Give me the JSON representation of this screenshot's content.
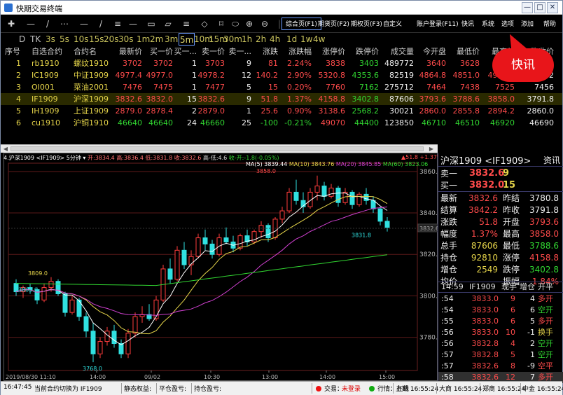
{
  "window": {
    "title": "快期交易终端",
    "controls": [
      "—",
      "□",
      "✕"
    ]
  },
  "toolbar": {
    "tools": [
      "✚",
      "—",
      "/",
      "⋯",
      "▭",
      "▱",
      "≡",
      "⬭",
      "◇",
      "⌑",
      "⊕",
      "⊖",
      "↻"
    ],
    "buttons": [
      "综合页(F1)",
      "期货页(F2)",
      "期权页(F3)",
      "自定义",
      "账户登录(F11)",
      "快讯",
      "系统",
      "选项",
      "添加",
      "帮助"
    ],
    "active_button": "综合页(F1)"
  },
  "periods": {
    "items": [
      "D",
      "TK",
      "3s",
      "5s",
      "10s",
      "15s",
      "20s",
      "30s",
      "1m",
      "2m",
      "3m",
      "5m",
      "10m",
      "15m",
      "30m",
      "1h",
      "2h",
      "4h",
      "1d",
      "1w",
      "4w"
    ],
    "active": "5m"
  },
  "quote_table": {
    "headers": [
      "序号",
      "自选合约",
      "合约名",
      "最新价",
      "买一价",
      "买一...",
      "卖一价",
      "卖一...",
      "涨跌",
      "涨跌幅",
      "涨停价",
      "跌停价",
      "成交量",
      "今开盘",
      "最低价",
      "最高价",
      "昨收价"
    ],
    "rows": [
      {
        "no": "1",
        "code": "rb1910",
        "name": "螺纹1910",
        "last": "3702",
        "bid": "3702",
        "bidvol": "1",
        "ask": "3703",
        "askvol": "9",
        "chg": "81",
        "pct": "2.24%",
        "up": "3838",
        "down": "3403",
        "vol": "489772",
        "open": "3640",
        "low": "3628",
        "high": "3715",
        "prev": "3621",
        "dir": "up"
      },
      {
        "no": "2",
        "code": "IC1909",
        "name": "中证1909",
        "last": "4977.4",
        "bid": "4977.0",
        "bidvol": "1",
        "ask": "4978.2",
        "askvol": "12",
        "chg": "140.2",
        "pct": "2.90%",
        "up": "5320.8",
        "down": "4353.6",
        "vol": "82519",
        "open": "4864.8",
        "low": "4851.0",
        "high": "4998.4",
        "prev": "4837.2",
        "dir": "up"
      },
      {
        "no": "3",
        "code": "OI001",
        "name": "菜油2001",
        "last": "7476",
        "bid": "7475",
        "bidvol": "1",
        "ask": "7477",
        "askvol": "5",
        "chg": "15",
        "pct": "0.20%",
        "up": "7760",
        "down": "7162",
        "vol": "275712",
        "open": "7464",
        "low": "7438",
        "high": "7525",
        "prev": "7456",
        "dir": "up"
      },
      {
        "no": "4",
        "code": "IF1909",
        "name": "沪深1909",
        "last": "3832.6",
        "bid": "3832.0",
        "bidvol": "15",
        "ask": "3832.6",
        "askvol": "9",
        "chg": "51.8",
        "pct": "1.37%",
        "up": "4158.8",
        "down": "3402.8",
        "vol": "87606",
        "open": "3793.6",
        "low": "3788.6",
        "high": "3858.0",
        "prev": "3791.8",
        "dir": "up",
        "selected": true
      },
      {
        "no": "5",
        "code": "IH1909",
        "name": "上证1909",
        "last": "2879.0",
        "bid": "2878.4",
        "bidvol": "2",
        "ask": "2879.0",
        "askvol": "1",
        "chg": "25.6",
        "pct": "0.90%",
        "up": "3138.6",
        "down": "2568.2",
        "vol": "30021",
        "open": "2860.0",
        "low": "2855.8",
        "high": "2894.2",
        "prev": "2860.0",
        "dir": "up"
      },
      {
        "no": "6",
        "code": "cu1910",
        "name": "沪铜1910",
        "last": "46640",
        "bid": "46640",
        "bidvol": "24",
        "ask": "46660",
        "askvol": "25",
        "chg": "-100",
        "pct": "-0.21%",
        "up": "49070",
        "down": "44400",
        "vol": "123850",
        "open": "46710",
        "low": "46510",
        "high": "46920",
        "prev": "46690",
        "dir": "down"
      }
    ]
  },
  "chart_header": {
    "left": "4.沪深1909 <IF1909> 5分钟 ▾",
    "open": "开:3834.4",
    "high": "高:3836.4",
    "low": "低:3831.8",
    "close": "收:3832.6",
    "hl": "高-低:4.6",
    "oc": "收-开:-1.8(-0.05%)",
    "right": "▲51.8 +1.37%"
  },
  "ma_info": [
    "MA(5) 3839.44",
    "MA(10) 3843.76",
    "MA(20) 3845.85",
    "MA(60) 3823.06"
  ],
  "chart_data": {
    "type": "candlestick",
    "y_ticks": [
      "3860.0",
      "3840.0",
      "3820.0",
      "3800.0",
      "3780.0"
    ],
    "ylim": [
      3764,
      3864
    ],
    "x_ticks": [
      "2019/08/30 11:10",
      "14:00",
      "09/02",
      "10:30",
      "13:00",
      "14:00",
      "15:00"
    ],
    "annotations": [
      "3858.0",
      "3809.0",
      "3803.0",
      "3768.0",
      "3831.8"
    ],
    "current_label": "3832.6",
    "candles": [
      [
        3806,
        3808,
        3800,
        3802
      ],
      [
        3802,
        3805,
        3799,
        3804
      ],
      [
        3804,
        3806,
        3801,
        3803
      ],
      [
        3803,
        3804,
        3796,
        3798
      ],
      [
        3798,
        3806,
        3797,
        3804
      ],
      [
        3804,
        3809,
        3802,
        3807
      ],
      [
        3807,
        3808,
        3800,
        3801
      ],
      [
        3801,
        3802,
        3790,
        3792
      ],
      [
        3792,
        3800,
        3791,
        3798
      ],
      [
        3798,
        3799,
        3788,
        3790
      ],
      [
        3790,
        3792,
        3780,
        3783
      ],
      [
        3783,
        3787,
        3768,
        3772
      ],
      [
        3772,
        3780,
        3770,
        3778
      ],
      [
        3778,
        3785,
        3776,
        3783
      ],
      [
        3783,
        3786,
        3775,
        3777
      ],
      [
        3777,
        3779,
        3770,
        3772
      ],
      [
        3772,
        3784,
        3770,
        3782
      ],
      [
        3782,
        3792,
        3780,
        3790
      ],
      [
        3790,
        3795,
        3787,
        3791
      ],
      [
        3791,
        3796,
        3788,
        3789
      ],
      [
        3789,
        3800,
        3788,
        3798
      ],
      [
        3798,
        3815,
        3797,
        3813
      ],
      [
        3813,
        3818,
        3806,
        3808
      ],
      [
        3808,
        3824,
        3807,
        3822
      ],
      [
        3822,
        3826,
        3813,
        3815
      ],
      [
        3815,
        3822,
        3810,
        3819
      ],
      [
        3819,
        3830,
        3818,
        3828
      ],
      [
        3828,
        3832,
        3822,
        3825
      ],
      [
        3825,
        3827,
        3818,
        3820
      ],
      [
        3820,
        3830,
        3819,
        3828
      ],
      [
        3828,
        3833,
        3825,
        3826
      ],
      [
        3826,
        3829,
        3821,
        3823
      ],
      [
        3823,
        3830,
        3822,
        3829
      ],
      [
        3829,
        3832,
        3824,
        3826
      ],
      [
        3826,
        3832,
        3825,
        3831
      ],
      [
        3831,
        3836,
        3828,
        3834
      ],
      [
        3834,
        3835,
        3826,
        3828
      ],
      [
        3828,
        3838,
        3827,
        3837
      ],
      [
        3837,
        3843,
        3835,
        3841
      ],
      [
        3841,
        3852,
        3840,
        3850
      ],
      [
        3850,
        3856,
        3844,
        3846
      ],
      [
        3846,
        3850,
        3840,
        3843
      ],
      [
        3843,
        3852,
        3842,
        3850
      ],
      [
        3850,
        3858,
        3846,
        3853
      ],
      [
        3853,
        3855,
        3846,
        3848
      ],
      [
        3848,
        3854,
        3847,
        3852
      ],
      [
        3852,
        3853,
        3843,
        3845
      ],
      [
        3845,
        3852,
        3844,
        3850
      ],
      [
        3850,
        3851,
        3842,
        3844
      ],
      [
        3844,
        3850,
        3843,
        3849
      ],
      [
        3849,
        3852,
        3844,
        3846
      ],
      [
        3846,
        3848,
        3840,
        3842
      ],
      [
        3842,
        3843,
        3834,
        3836
      ],
      [
        3836,
        3838,
        3831,
        3833
      ]
    ]
  },
  "right_panel": {
    "title": "沪深1909 <IF1909>",
    "tab": "资讯",
    "ask": {
      "label": "卖一",
      "price": "3832.6",
      "vol": "9"
    },
    "bid": {
      "label": "买一",
      "price": "3832.0",
      "vol": "15"
    },
    "stats": [
      [
        "最新",
        "3832.6",
        "昨结",
        "3780.8"
      ],
      [
        "结算",
        "3842.2",
        "昨收",
        "3791.8"
      ],
      [
        "涨跌",
        "51.8",
        "开盘",
        "3793.6"
      ],
      [
        "幅度",
        "1.37%",
        "最高",
        "3858.0"
      ],
      [
        "总手",
        "87606",
        "最低",
        "3788.6"
      ],
      [
        "持仓",
        "92810",
        "涨停",
        "4158.8"
      ],
      [
        "增仓",
        "2549",
        "跌停",
        "3402.8"
      ],
      [
        "均价",
        "",
        "振幅",
        "1.84%"
      ]
    ],
    "ticks_header": [
      "14:59",
      "IF1909",
      "现手",
      "增仓",
      "开平"
    ],
    "ticks": [
      [
        ":54",
        "3833.0",
        "9",
        "4",
        "多开",
        "red"
      ],
      [
        ":54",
        "3833.0",
        "6",
        "6",
        "空开",
        "green"
      ],
      [
        ":55",
        "3833.0",
        "6",
        "5",
        "多开",
        "red"
      ],
      [
        ":56",
        "3833.0",
        "10",
        "-1",
        "换手",
        "yellow"
      ],
      [
        ":56",
        "3832.8",
        "4",
        "2",
        "空开",
        "green"
      ],
      [
        ":57",
        "3832.8",
        "5",
        "1",
        "空开",
        "green"
      ],
      [
        ":57",
        "3832.6",
        "8",
        "-9",
        "空平",
        "red"
      ],
      [
        ":58",
        "3832.6",
        "12",
        "7",
        "多开",
        "red"
      ],
      [
        ":58",
        "3832.6",
        "6",
        "3",
        "空开",
        "green"
      ]
    ]
  },
  "status_bar": {
    "time": "16:47:45",
    "message": "当前合约切换为 IF1909",
    "static_equity": "静态权益:",
    "close_pnl": "平仓盈亏:",
    "position_pnl": "持仓盈亏:",
    "trade_label": "交易：",
    "trade_status": "未登录",
    "market_status": "行情：在线",
    "exchanges": [
      "上期 16:55:24",
      "大商 16:55:24",
      "郑商 16:55:24",
      "中金 16:55:24"
    ]
  },
  "callout": {
    "text": "快讯"
  },
  "colors": {
    "up": "#ff4b4b",
    "down": "#31d631",
    "code": "#e6d54a",
    "accent": "#e8151a"
  }
}
